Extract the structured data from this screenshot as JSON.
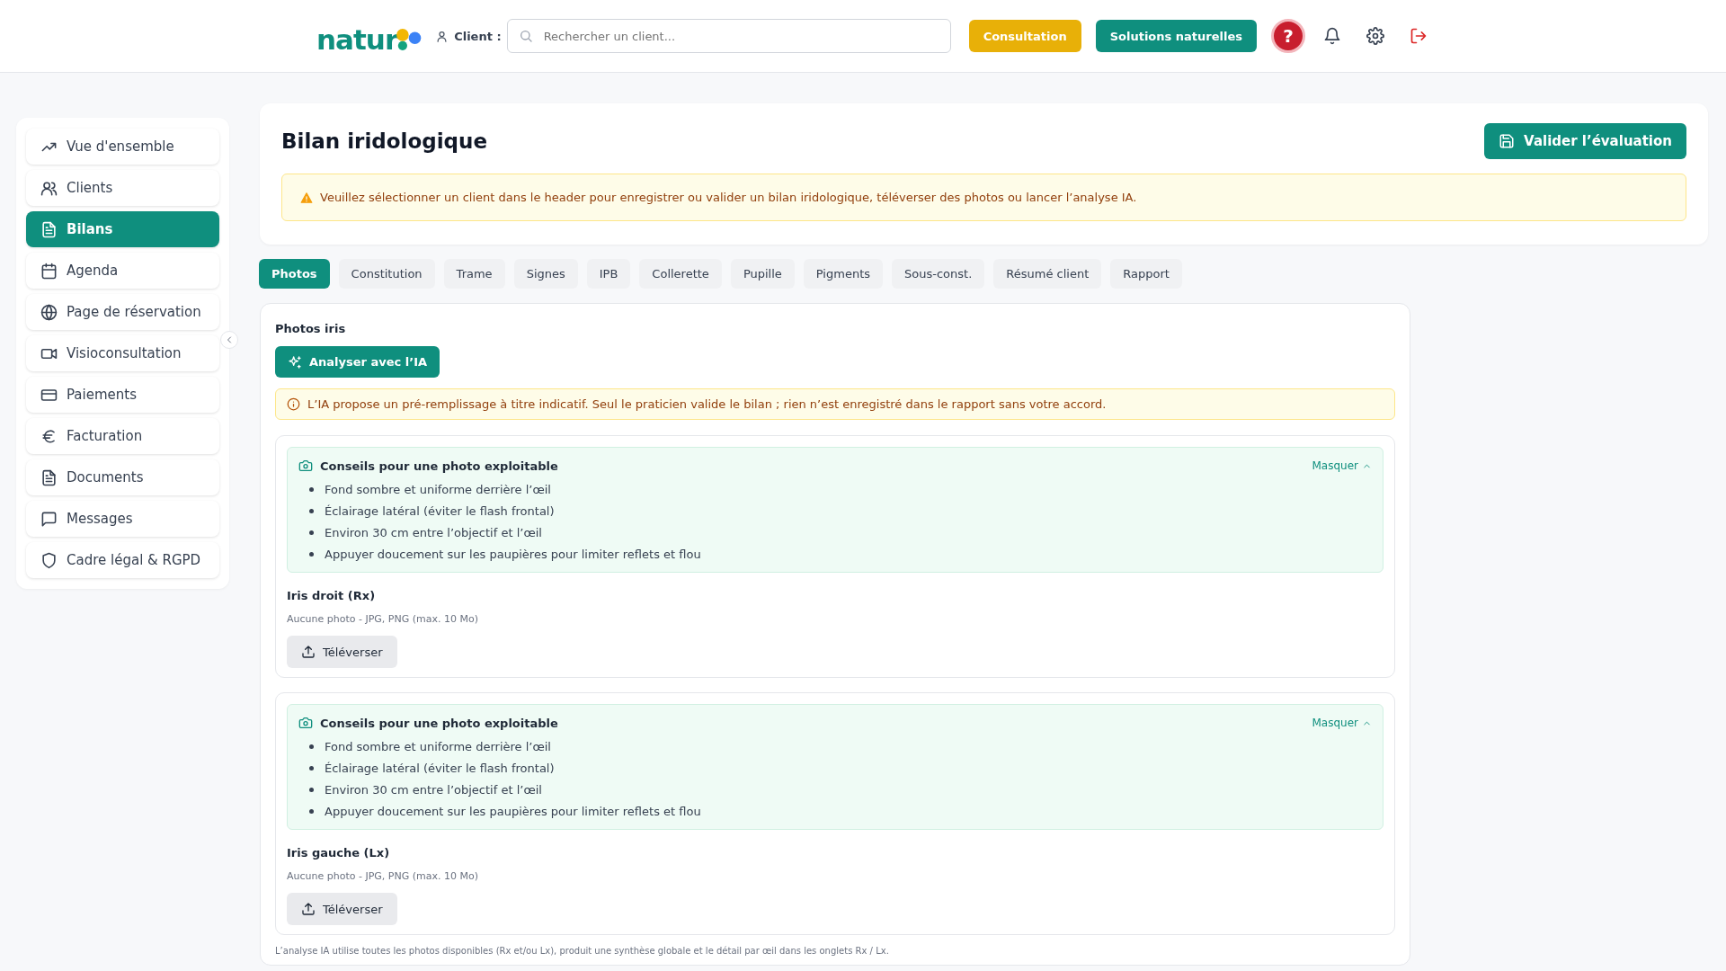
{
  "header": {
    "logo": "natur",
    "client_label": "Client :",
    "search": {
      "placeholder": "Rechercher un client..."
    },
    "buttons": [
      {
        "label": "Consultation",
        "kind": "warning"
      },
      {
        "label": "Solutions naturelles",
        "kind": "primary"
      }
    ],
    "help": "?"
  },
  "sidebar": {
    "items": [
      {
        "label": "Vue d'ensemble",
        "selected": false
      },
      {
        "label": "Clients",
        "selected": false
      },
      {
        "label": "Bilans",
        "selected": true
      },
      {
        "label": "Agenda",
        "selected": false
      },
      {
        "label": "Page de réservation",
        "selected": false
      },
      {
        "label": "Visioconsultation",
        "selected": false
      },
      {
        "label": "Paiements",
        "selected": false
      },
      {
        "label": "Facturation",
        "selected": false
      },
      {
        "label": "Documents",
        "selected": false
      },
      {
        "label": "Messages",
        "selected": false
      },
      {
        "label": "Cadre légal & RGPD",
        "selected": false
      }
    ]
  },
  "page": {
    "title": "Bilan iridologique",
    "validate_button": "Valider l’évaluation",
    "warning": "Veuillez sélectionner un client dans le header pour enregistrer ou valider un bilan iridologique, téléverser des photos ou lancer l’analyse IA."
  },
  "tabs": [
    {
      "label": "Photos",
      "selected": true
    },
    {
      "label": "Constitution",
      "selected": false
    },
    {
      "label": "Trame",
      "selected": false
    },
    {
      "label": "Signes",
      "selected": false
    },
    {
      "label": "IPB",
      "selected": false
    },
    {
      "label": "Collerette",
      "selected": false
    },
    {
      "label": "Pupille",
      "selected": false
    },
    {
      "label": "Pigments",
      "selected": false
    },
    {
      "label": "Sous-const.",
      "selected": false
    },
    {
      "label": "Résumé client",
      "selected": false
    },
    {
      "label": "Rapport",
      "selected": false
    }
  ],
  "photos": {
    "title": "Photos iris",
    "analyze_button": "Analyser avec l’IA",
    "notice": "L’IA propose un pré-remplissage à titre indicatif. Seul le praticien valide le bilan ; rien n’est enregistré dans le rapport sans votre accord.",
    "sections": [
      {
        "tips_title": "Conseils pour une photo exploitable",
        "toggle": "Masquer",
        "expanded": true,
        "tips": [
          "Fond sombre et uniforme derrière l’œil",
          "Éclairage latéral (éviter le flash frontal)",
          "Environ 30 cm entre l’objectif et l’œil",
          "Appuyer doucement sur les paupières pour limiter reflets et flou"
        ],
        "eye_label": "Iris droit (Rx)",
        "caption": "Aucune photo - JPG, PNG (max. 10 Mo)",
        "upload_button": "Téléverser"
      },
      {
        "tips_title": "Conseils pour une photo exploitable",
        "toggle": "Masquer",
        "expanded": true,
        "tips": [
          "Fond sombre et uniforme derrière l’œil",
          "Éclairage latéral (éviter le flash frontal)",
          "Environ 30 cm entre l’objectif et l’œil",
          "Appuyer doucement sur les paupières pour limiter reflets et flou"
        ],
        "eye_label": "Iris gauche (Lx)",
        "caption": "Aucune photo - JPG, PNG (max. 10 Mo)",
        "upload_button": "Téléverser"
      }
    ],
    "footnote": "L’analyse IA utilise toutes les photos disponibles (Rx et/ou Lx), produit une synthèse globale et le détail par œil dans les onglets Rx / Lx."
  }
}
